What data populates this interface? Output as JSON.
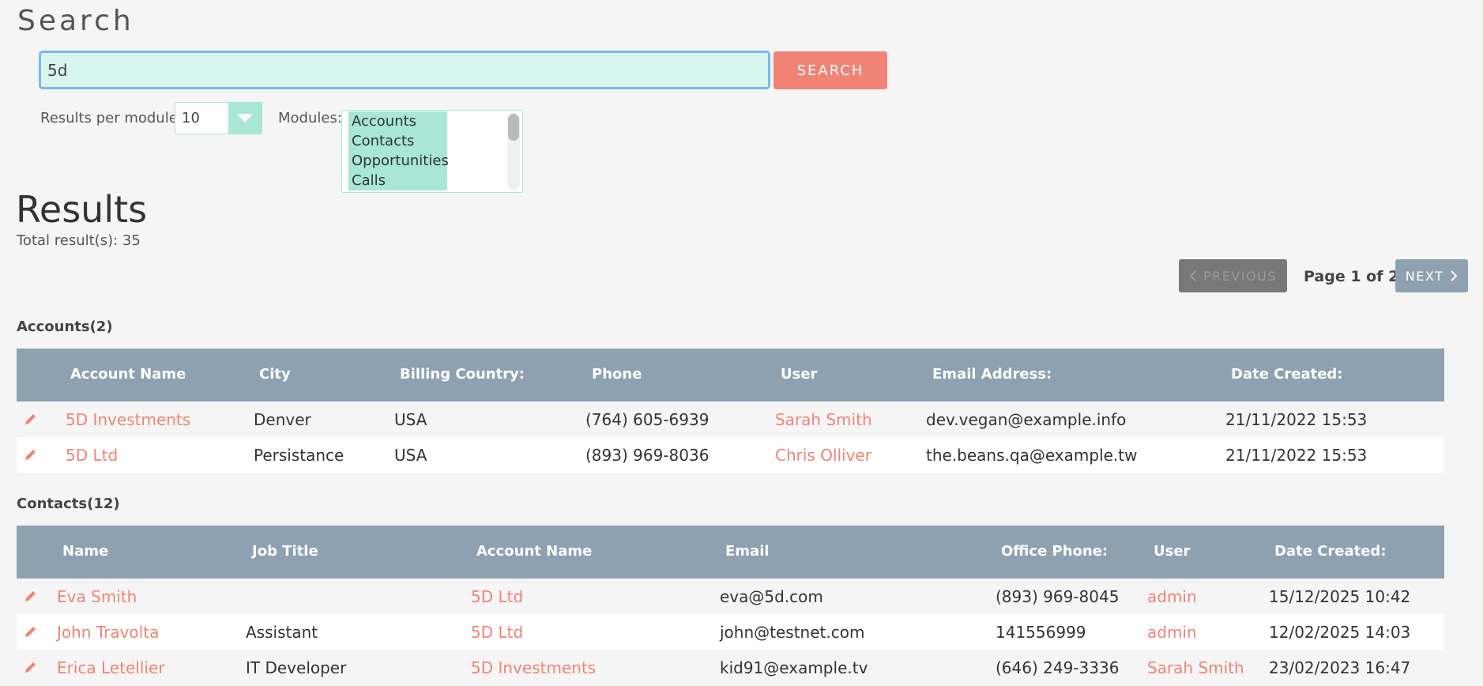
{
  "search": {
    "title": "Search",
    "query": "5d",
    "button_label": "SEARCH",
    "results_per_module_label": "Results per module:",
    "results_per_module_value": "10",
    "modules_label": "Modules:",
    "modules": [
      "Accounts",
      "Contacts",
      "Opportunities",
      "Calls"
    ]
  },
  "results": {
    "title": "Results",
    "total": "Total result(s): 35",
    "pagination": {
      "previous_label": "PREVIOUS",
      "page_info": "Page 1 of 2",
      "next_label": "NEXT"
    }
  },
  "accounts": {
    "title": "Accounts(2)",
    "columns": [
      "Account Name",
      "City",
      "Billing Country:",
      "Phone",
      "User",
      "Email Address:",
      "Date Created:"
    ],
    "rows": [
      [
        "5D Investments",
        "Denver",
        "USA",
        "(764) 605-6939",
        "Sarah Smith",
        "dev.vegan@example.info",
        "21/11/2022 15:53"
      ],
      [
        "5D Ltd",
        "Persistance",
        "USA",
        "(893) 969-8036",
        "Chris Olliver",
        "the.beans.qa@example.tw",
        "21/11/2022 15:53"
      ]
    ]
  },
  "contacts": {
    "title": "Contacts(12)",
    "columns": [
      "Name",
      "Job Title",
      "Account Name",
      "Email",
      "Office Phone:",
      "User",
      "Date Created:"
    ],
    "rows": [
      [
        "Eva Smith",
        "",
        "5D Ltd",
        "eva@5d.com",
        "(893) 969-8045",
        "admin",
        "15/12/2025 10:42"
      ],
      [
        "John Travolta",
        "Assistant",
        "5D Ltd",
        "john@testnet.com",
        "141556999",
        "admin",
        "12/02/2025 14:03"
      ],
      [
        "Erica Letellier",
        "IT Developer",
        "5D Investments",
        "kid91@example.tv",
        "(646) 249-3336",
        "Sarah Smith",
        "23/02/2023 16:47"
      ]
    ]
  },
  "colors": {
    "accent": "#f08376",
    "table_header": "#8ea1b1",
    "highlight": "#a8e6d6"
  }
}
